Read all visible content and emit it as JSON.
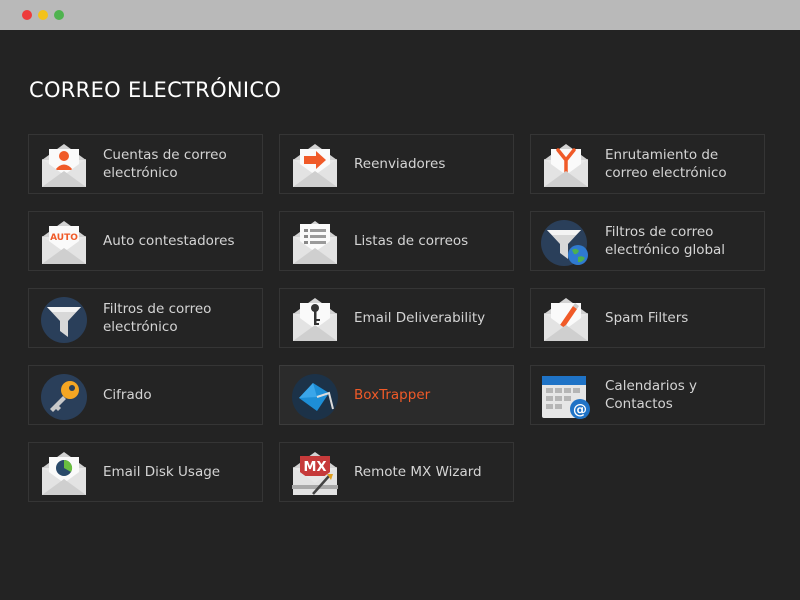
{
  "section": {
    "title": "CORREO ELECTRÓNICO"
  },
  "tiles": [
    {
      "label": "Cuentas de correo electrónico",
      "icon": "envelope-user-icon"
    },
    {
      "label": "Reenviadores",
      "icon": "envelope-forward-icon"
    },
    {
      "label": "Enrutamiento de correo electrónico",
      "icon": "envelope-routing-icon"
    },
    {
      "label": "Auto contestadores",
      "icon": "envelope-auto-icon",
      "icon_text": "AUTO"
    },
    {
      "label": "Listas de correos",
      "icon": "envelope-list-icon"
    },
    {
      "label": "Filtros de correo electrónico global",
      "icon": "funnel-globe-icon"
    },
    {
      "label": "Filtros de correo electrónico",
      "icon": "funnel-icon"
    },
    {
      "label": "Email Deliverability",
      "icon": "envelope-key-icon"
    },
    {
      "label": "Spam Filters",
      "icon": "envelope-pencil-icon"
    },
    {
      "label": "Cifrado",
      "icon": "key-icon"
    },
    {
      "label": "BoxTrapper",
      "icon": "boxtrapper-icon",
      "active": true
    },
    {
      "label": "Calendarios y Contactos",
      "icon": "calendar-contacts-icon"
    },
    {
      "label": "Email Disk Usage",
      "icon": "envelope-pie-icon"
    },
    {
      "label": "Remote MX Wizard",
      "icon": "remote-mx-icon",
      "icon_text": "MX"
    }
  ],
  "colors": {
    "accent": "#f05a28",
    "background": "#232323",
    "tile_border": "#353535",
    "text": "#d4d4d4"
  }
}
